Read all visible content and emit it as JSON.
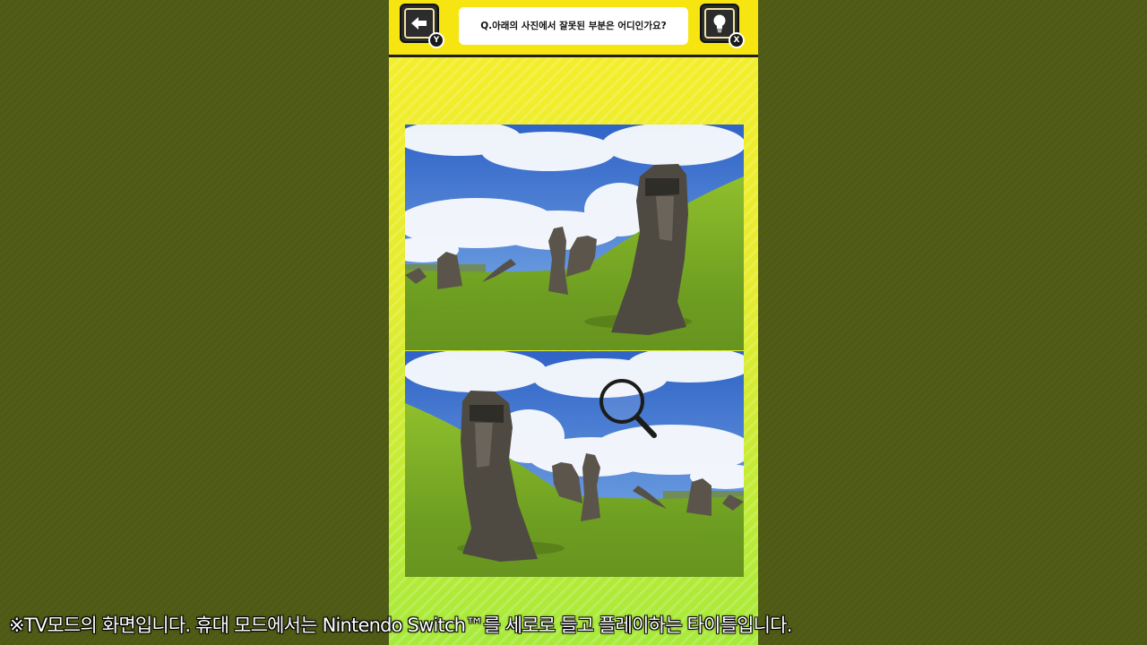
{
  "header": {
    "question": "Q.아래의 사진에서 잘못된 부분은 어디인가요?",
    "back_button": {
      "icon": "left-arrow-icon",
      "badge": "Y"
    },
    "hint_button": {
      "icon": "lightbulb-icon",
      "badge": "X"
    }
  },
  "puzzle": {
    "top_photo": "moai statues on grassy hillside (original)",
    "bottom_photo": "moai statues on grassy hillside (mirrored)",
    "cursor_icon": "magnifying-glass-icon"
  },
  "footer": {
    "disclaimer": "※TV모드의 화면입니다. 휴대 모드에서는 Nintendo Switch™를 세로로 들고 플레이하는 타이틀입니다."
  },
  "colors": {
    "background": "#515d16",
    "header": "#f6e510",
    "panel_top": "#f7ee2a",
    "panel_bottom": "#a7ea3a"
  }
}
